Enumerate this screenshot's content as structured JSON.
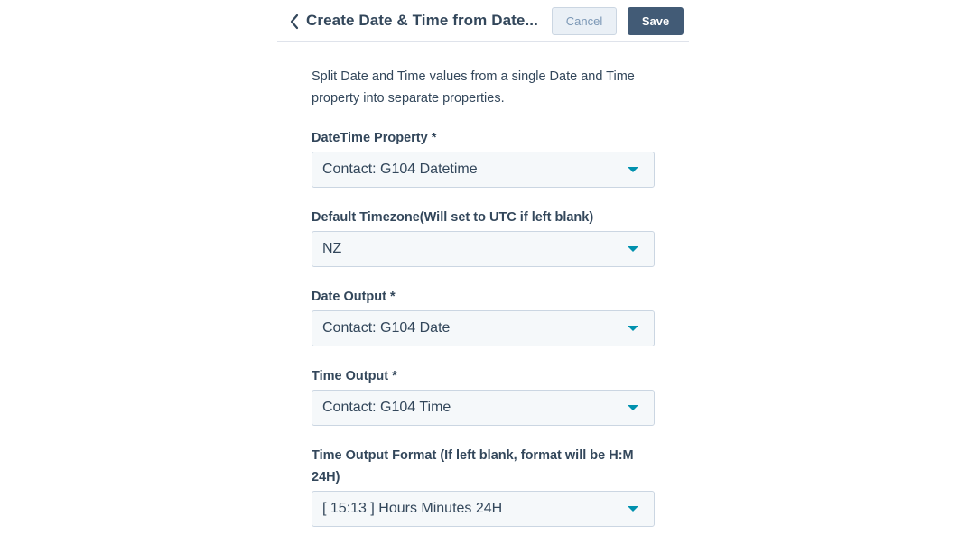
{
  "header": {
    "title": "Create Date & Time from Date...",
    "cancel_label": "Cancel",
    "save_label": "Save",
    "back_icon": "chevron-left-icon"
  },
  "description": "Split Date and Time values from a single Date and Time property into separate properties.",
  "fields": [
    {
      "label": "DateTime Property *",
      "value": "Contact: G104 Datetime"
    },
    {
      "label": "Default Timezone(Will set to UTC if left blank)",
      "value": "NZ"
    },
    {
      "label": "Date Output *",
      "value": "Contact: G104 Date"
    },
    {
      "label": "Time Output *",
      "value": "Contact: G104 Time"
    },
    {
      "label": "Time Output Format (If left blank, format will be H:M 24H)",
      "value": "[ 15:13 ] Hours Minutes 24H"
    }
  ],
  "colors": {
    "text": "#33475b",
    "accent_caret": "#0091ae",
    "save_button": "#425b76",
    "cancel_button": "#eaf0f6",
    "select_background": "#f5f8fa",
    "border": "#cbd6e2"
  }
}
